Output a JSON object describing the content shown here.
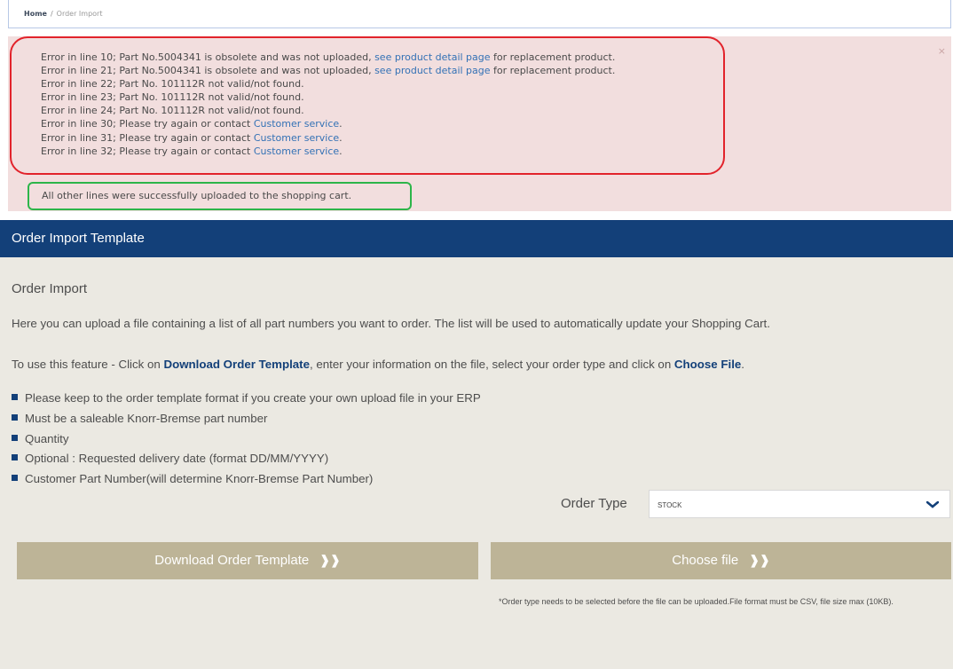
{
  "breadcrumb": {
    "home": "Home",
    "separator": "/",
    "current": "Order Import"
  },
  "alert": {
    "close": "×",
    "errors": [
      {
        "text": "Error in line 10; Part No.5004341 is obsolete and was not uploaded, ",
        "link": "see product detail page",
        "after": " for replacement product."
      },
      {
        "text": "Error in line 21; Part No.5004341 is obsolete and was not uploaded, ",
        "link": "see product detail page",
        "after": " for replacement product."
      },
      {
        "text": "Error in line 22; Part No. 101112R not valid/not found.",
        "link": "",
        "after": ""
      },
      {
        "text": "Error in line 23; Part No. 101112R not valid/not found.",
        "link": "",
        "after": ""
      },
      {
        "text": "Error in line 24; Part No. 101112R not valid/not found.",
        "link": "",
        "after": ""
      },
      {
        "text": "Error in line 30; Please try again or contact ",
        "link": "Customer service",
        "after": "."
      },
      {
        "text": "Error in line 31; Please try again or contact ",
        "link": "Customer service",
        "after": "."
      },
      {
        "text": "Error in line 32; Please try again or contact ",
        "link": "Customer service",
        "after": "."
      }
    ],
    "success": "All other lines were successfully uploaded to the shopping cart."
  },
  "panel": {
    "header": "Order Import Template",
    "title": "Order Import",
    "intro": "Here you can upload a file containing a list of all part numbers you want to order. The list will be used to automatically update your Shopping Cart.",
    "how": {
      "prefix": "To use this feature - Click on ",
      "download_link": "Download Order Template",
      "middle": ", enter your information on the file, select your order type and click on ",
      "choose_link": "Choose File",
      "suffix": "."
    },
    "bullets": [
      "Please keep to the order template format if you create your own upload file in your ERP",
      "Must be a saleable Knorr-Bremse part number",
      "Quantity",
      "Optional : Requested delivery date (format DD/MM/YYYY)",
      "Customer Part Number(will determine Knorr-Bremse Part Number)"
    ],
    "order_type_label": "Order Type",
    "order_type_value": "STOCK",
    "download_button": "Download Order Template",
    "choose_button": "Choose file",
    "button_arrows": "❱❱",
    "note": "*Order type needs to be selected before the file can be uploaded.File format must be CSV, file size max (10KB)."
  },
  "colors": {
    "header_bg": "#134079",
    "panel_bg": "#ebe9e2",
    "button_bg": "#bdb497",
    "alert_bg": "#f2dede",
    "error_outline": "#e2232b",
    "success_outline": "#2db54a",
    "link": "#3371b5"
  }
}
